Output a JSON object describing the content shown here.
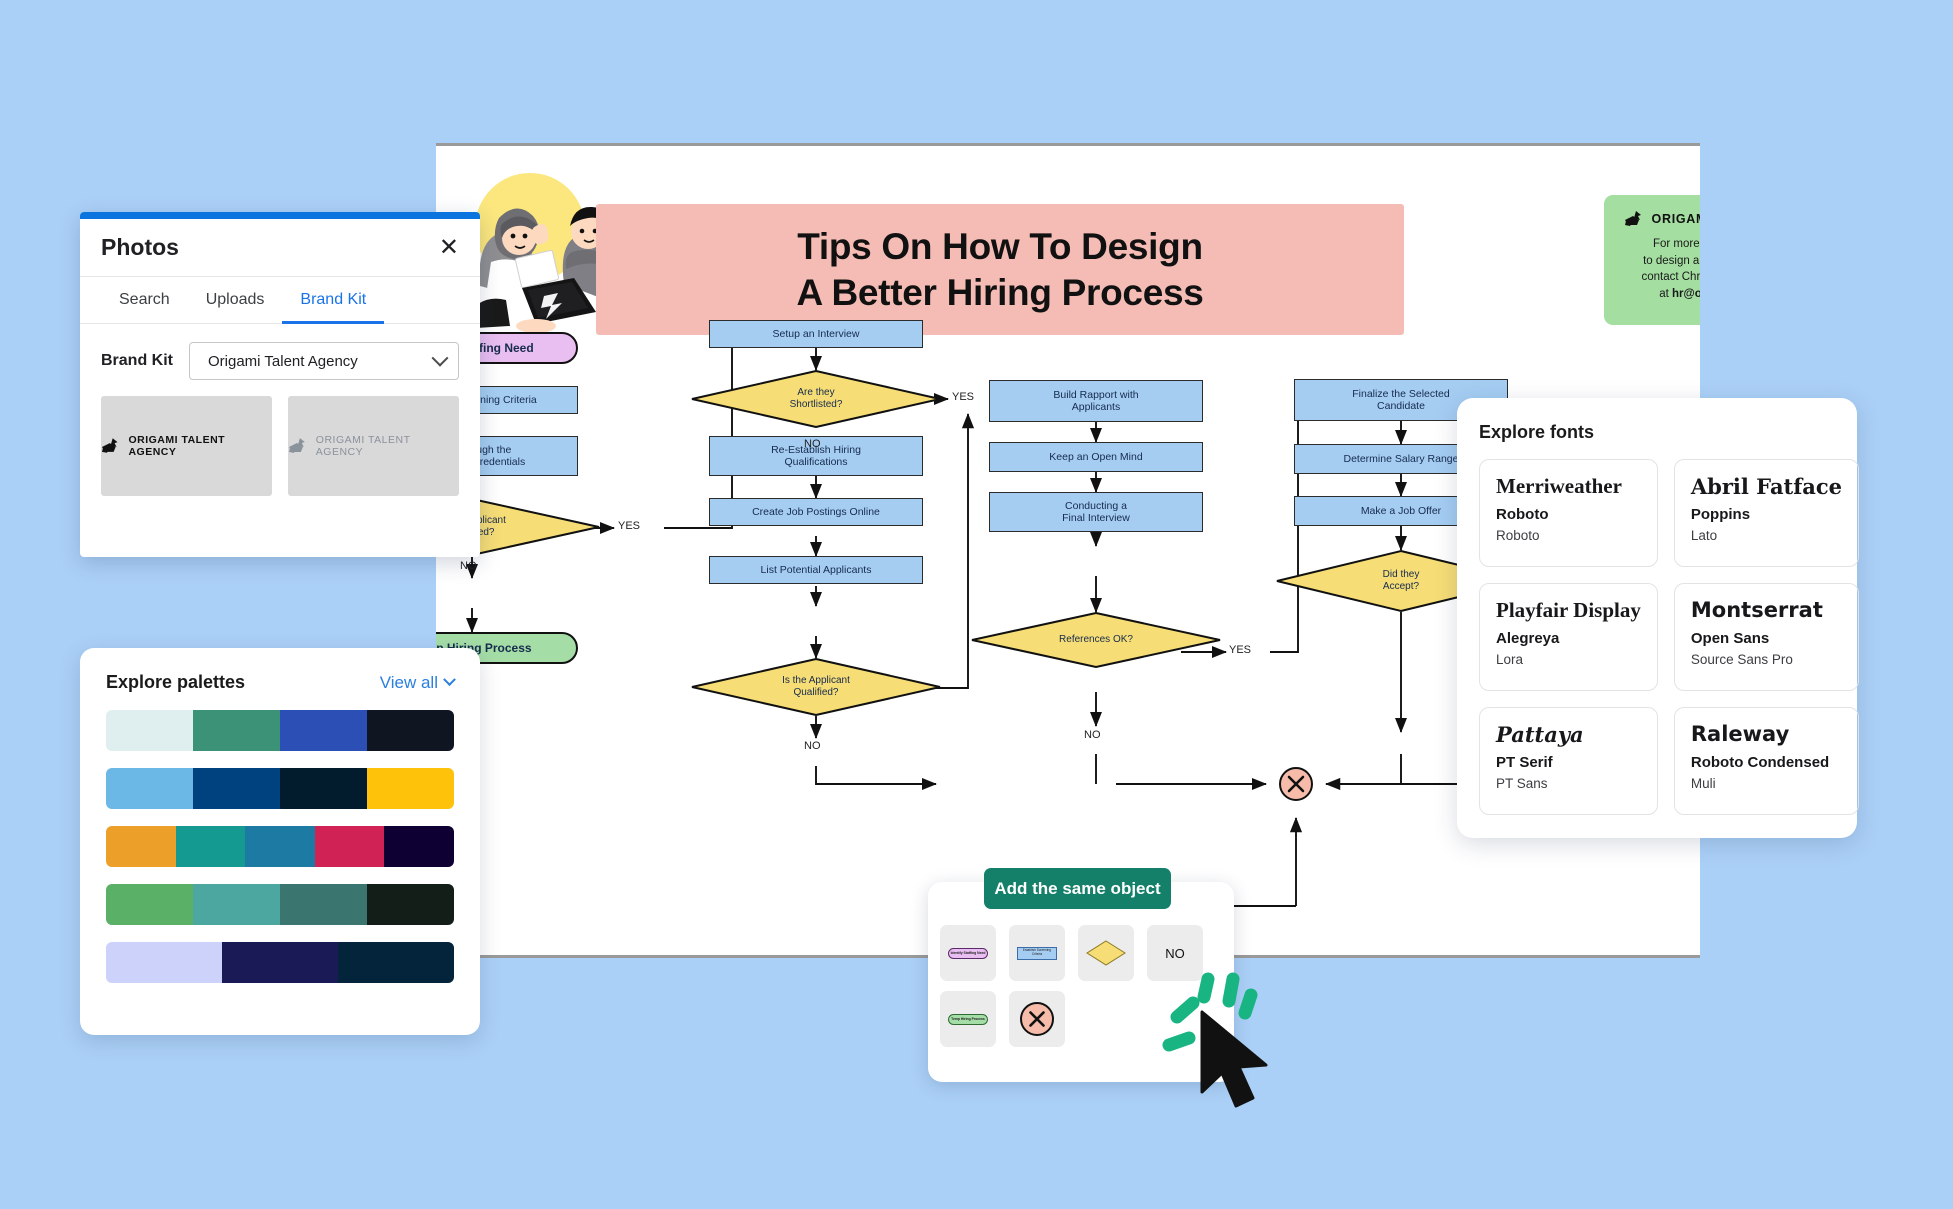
{
  "background_color": "#abd0f7",
  "photos_panel": {
    "accent_color": "#0c74df",
    "title": "Photos",
    "close_icon": "close-icon",
    "tabs": [
      {
        "label": "Search",
        "active": false
      },
      {
        "label": "Uploads",
        "active": false
      },
      {
        "label": "Brand Kit",
        "active": true
      }
    ],
    "brand_kit_label": "Brand Kit",
    "brand_kit_value": "Origami Talent Agency",
    "logo_tiles": [
      {
        "label": "ORIGAMI TALENT AGENCY",
        "muted": false
      },
      {
        "label": "ORIGAMI TALENT AGENCY",
        "muted": true
      }
    ]
  },
  "palettes_panel": {
    "title": "Explore palettes",
    "view_all": "View all",
    "rows": [
      [
        "#dfeeee",
        "#3c9276",
        "#2b4fb5",
        "#0f1521"
      ],
      [
        "#6bb8e6",
        "#004280",
        "#021c2e",
        "#ffc20a"
      ],
      [
        "#eda029",
        "#149a90",
        "#1d7aa3",
        "#d02254",
        "#0f0033"
      ],
      [
        "#59b066",
        "#4ca7a1",
        "#3a7570",
        "#141e19"
      ],
      [
        "#cdd2fb",
        "#191a56",
        "#03243a"
      ]
    ]
  },
  "fonts_panel": {
    "title": "Explore fonts",
    "cards": [
      {
        "hero": "Merriweather",
        "mid": "Roboto",
        "sub": "Roboto",
        "hero_style": "serif"
      },
      {
        "hero": "Abril Fatface",
        "mid": "Poppins",
        "sub": "Lato",
        "hero_style": "serif-d"
      },
      {
        "hero": "Playfair Display",
        "mid": "Alegreya",
        "sub": "Lora",
        "hero_style": "serif"
      },
      {
        "hero": "Montserrat",
        "mid": "Open Sans",
        "sub": "Source Sans Pro",
        "hero_style": "sans-b"
      },
      {
        "hero": "Pattaya",
        "mid": "PT Serif",
        "sub": "PT Sans",
        "hero_style": "serif-ital"
      },
      {
        "hero": "Raleway",
        "mid": "Roboto Condensed",
        "sub": "Muli",
        "hero_style": "sans-b"
      }
    ]
  },
  "document": {
    "title_line1": "Tips On How To Design",
    "title_line2": "A Better Hiring Process",
    "banner_color": "#f4bcb4",
    "contact_card": {
      "background_color": "#a4dea1",
      "brand_name": "ORIGAMI TALENT AGENCY",
      "line1": "For more information on how",
      "line2": "to design a better hiring process,",
      "line3": "contact Chris Dobre HR Manager",
      "line4_prefix": "at ",
      "email": "hr@origamitalent.com"
    }
  },
  "flowchart": {
    "colors": {
      "process": "#a5cdf2",
      "decision": "#f6dd76",
      "start": "#e9bef0",
      "end": "#a5dda7",
      "terminator": "#f6bba9"
    },
    "nodes": [
      {
        "id": "n1",
        "type": "start",
        "label": "Identify Staffing Need"
      },
      {
        "id": "n2",
        "type": "process",
        "label": "Establish Screening Criteria"
      },
      {
        "id": "n3",
        "type": "process",
        "label": "Run Through the\nApplicant's Credentials"
      },
      {
        "id": "n4",
        "type": "decision",
        "label": "Is the Applicant\nQualified?"
      },
      {
        "id": "n5",
        "type": "end",
        "label": "Temp Hiring Process"
      },
      {
        "id": "n6",
        "type": "process",
        "label": "Setup an Interview"
      },
      {
        "id": "n7",
        "type": "decision",
        "label": "Are they\nShortlisted?"
      },
      {
        "id": "n8",
        "type": "process",
        "label": "Re-Establish Hiring\nQualifications"
      },
      {
        "id": "n9",
        "type": "process",
        "label": "Create Job Postings Online"
      },
      {
        "id": "n10",
        "type": "process",
        "label": "List Potential Applicants"
      },
      {
        "id": "n11",
        "type": "decision",
        "label": "Is the Applicant\nQualified?"
      },
      {
        "id": "n12",
        "type": "process",
        "label": "Build Rapport with\nApplicants"
      },
      {
        "id": "n13",
        "type": "process",
        "label": "Keep an Open Mind"
      },
      {
        "id": "n14",
        "type": "process",
        "label": "Conducting a\nFinal Interview"
      },
      {
        "id": "n15",
        "type": "decision",
        "label": "References OK?"
      },
      {
        "id": "n16",
        "type": "process",
        "label": "Finalize the Selected\nCandidate"
      },
      {
        "id": "n17",
        "type": "process",
        "label": "Determine Salary Range"
      },
      {
        "id": "n18",
        "type": "process",
        "label": "Make a Job Offer"
      },
      {
        "id": "n19",
        "type": "decision",
        "label": "Did they\nAccept?"
      },
      {
        "id": "n20",
        "type": "terminator",
        "label": "X"
      }
    ],
    "edge_labels": {
      "yes1": "YES",
      "no1": "NO",
      "yes2": "YES",
      "no2": "NO",
      "yes3": "YES",
      "no3": "NO",
      "yes4": "YES",
      "no4": "NO",
      "no5": "NO"
    }
  },
  "add_object_popup": {
    "button_label": "Add the same object",
    "button_color": "#15806a",
    "tiles": [
      {
        "kind": "pill-purple",
        "label": "Identify Staffing Need"
      },
      {
        "kind": "rect-blue",
        "label": "Establish Screening Criteria"
      },
      {
        "kind": "diamond-yellow",
        "label": "Is the Applicant Qualified?"
      },
      {
        "kind": "text",
        "label": "NO"
      },
      {
        "kind": "pill-green",
        "label": "Temp Hiring Process"
      },
      {
        "kind": "circle-x",
        "label": "X"
      }
    ]
  },
  "cursor": {
    "icon": "mouse-pointer-icon",
    "burst_color": "#18b583"
  }
}
